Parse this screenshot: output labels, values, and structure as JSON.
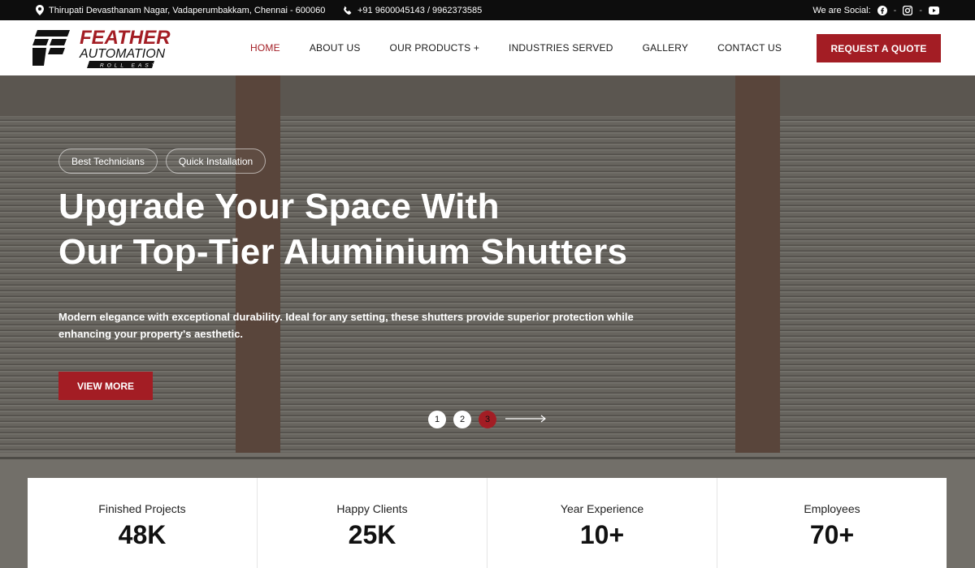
{
  "topbar": {
    "address": "Thirupati Devasthanam Nagar, Vadaperumbakkam, Chennai - 600060",
    "phone": "+91 9600045143 / 9962373585",
    "social_label": "We are Social:",
    "icons": [
      "location-pin-icon",
      "phone-icon",
      "facebook-icon",
      "instagram-icon",
      "youtube-icon"
    ]
  },
  "header": {
    "logo": {
      "line1": "FEATHER",
      "line2": "AUTOMATION",
      "tagline": "ROLL EASY"
    },
    "nav": [
      "HOME",
      "ABOUT US",
      "OUR PRODUCTS +",
      "INDUSTRIES SERVED",
      "GALLERY",
      "CONTACT US"
    ],
    "active_nav": "HOME",
    "cta": "REQUEST A QUOTE"
  },
  "hero": {
    "chips": [
      "Best Technicians",
      "Quick Installation"
    ],
    "title_line1": "Upgrade Your Space With",
    "title_line2": "Our Top-Tier Aluminium Shutters",
    "description": "Modern elegance with exceptional durability. Ideal for any setting, these shutters provide superior protection while enhancing your property's aesthetic.",
    "button": "VIEW MORE",
    "pages": [
      "1",
      "2",
      "3"
    ],
    "active_page": "3"
  },
  "stats": [
    {
      "label": "Finished Projects",
      "value": "48K"
    },
    {
      "label": "Happy Clients",
      "value": "25K"
    },
    {
      "label": "Year Experience",
      "value": "10+"
    },
    {
      "label": "Employees",
      "value": "70+"
    }
  ],
  "colors": {
    "accent": "#a31d24",
    "topbar": "#0d0d0d",
    "text": "#111111"
  }
}
